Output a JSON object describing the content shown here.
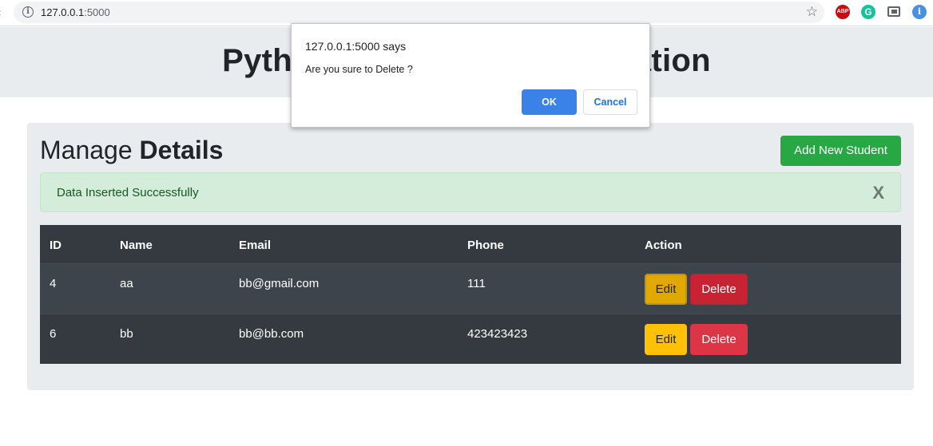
{
  "browser": {
    "url_host": "127.0.0.1",
    "url_port": ":5000",
    "back_glyph": "‹",
    "extensions": {
      "abp_label": "ABP",
      "grammarly_label": "G",
      "info_label": "i"
    }
  },
  "header": {
    "title": "Python Flask CRUD Application"
  },
  "panel": {
    "heading_normal": "Manage ",
    "heading_bold": "Details",
    "add_button_label": "Add New Student",
    "alert": {
      "text": "Data Inserted Successfully",
      "close_label": "X"
    }
  },
  "table": {
    "columns": [
      "ID",
      "Name",
      "Email",
      "Phone",
      "Action"
    ],
    "rows": [
      {
        "id": "4",
        "name": "aa",
        "email": "bb@gmail.com",
        "phone": "111",
        "edit_label": "Edit",
        "delete_label": "Delete"
      },
      {
        "id": "6",
        "name": "bb",
        "email": "bb@bb.com",
        "phone": "423423423",
        "edit_label": "Edit",
        "delete_label": "Delete"
      }
    ]
  },
  "dialog": {
    "title": "127.0.0.1:5000 says",
    "message": "Are you sure to Delete ?",
    "ok_label": "OK",
    "cancel_label": "Cancel"
  },
  "colors": {
    "success": "#28a745",
    "warning": "#ffc107",
    "danger": "#dc3545",
    "table_dark": "#343a40",
    "dialog_primary": "#3b82e8"
  }
}
